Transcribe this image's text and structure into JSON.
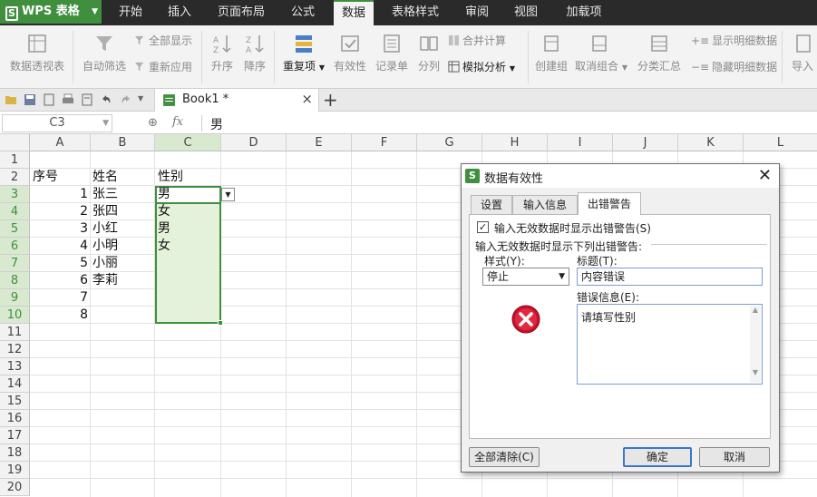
{
  "app": {
    "logo": "WPS 表格",
    "menu_tabs": [
      "开始",
      "插入",
      "页面布局",
      "公式",
      "数据",
      "表格样式",
      "审阅",
      "视图",
      "加载项"
    ],
    "active_tab": "数据"
  },
  "ribbon": {
    "pivot_table": "数据透视表",
    "auto_filter": "自动筛选",
    "show_all": "全部显示",
    "reapply": "重新应用",
    "sort_asc": "升序",
    "sort_desc": "降序",
    "duplicates": "重复项",
    "validation": "有效性",
    "record_form": "记录单",
    "text_to_columns": "分列",
    "consolidate": "合并计算",
    "what_if": "模拟分析",
    "group": "创建组",
    "ungroup": "取消组合",
    "subtotal": "分类汇总",
    "show_detail": "显示明细数据",
    "hide_detail": "隐藏明细数据",
    "import": "导入"
  },
  "document": {
    "tab_title": "Book1 *"
  },
  "formula_bar": {
    "name_box": "C3",
    "fx": "fx",
    "value": "男"
  },
  "sheet": {
    "columns": [
      "A",
      "B",
      "C",
      "D",
      "E",
      "F",
      "G",
      "H",
      "I",
      "J",
      "K",
      "L"
    ],
    "rows": [
      "1",
      "2",
      "3",
      "4",
      "5",
      "6",
      "7",
      "8",
      "9",
      "10",
      "11",
      "12",
      "13",
      "14",
      "15",
      "16",
      "17",
      "18",
      "19",
      "20"
    ],
    "header_row": {
      "a": "序号",
      "b": "姓名",
      "c": "性别"
    },
    "data": [
      {
        "a": "1",
        "b": "张三",
        "c": "男"
      },
      {
        "a": "2",
        "b": "张四",
        "c": "女"
      },
      {
        "a": "3",
        "b": "小红",
        "c": "男"
      },
      {
        "a": "4",
        "b": "小明",
        "c": "女"
      },
      {
        "a": "5",
        "b": "小丽",
        "c": ""
      },
      {
        "a": "6",
        "b": "李莉",
        "c": ""
      },
      {
        "a": "7",
        "b": "",
        "c": ""
      },
      {
        "a": "8",
        "b": "",
        "c": ""
      }
    ]
  },
  "dialog": {
    "title": "数据有效性",
    "tabs": [
      "设置",
      "输入信息",
      "出错警告"
    ],
    "active_tab": "出错警告",
    "show_alert_label": "输入无效数据时显示出错警告(S)",
    "show_alert_checked": true,
    "group_label": "输入无效数据时显示下列出错警告:",
    "style_label": "样式(Y):",
    "style_value": "停止",
    "title_label": "标题(T):",
    "title_value": "内容错误",
    "message_label": "错误信息(E):",
    "message_value": "请填写性别",
    "clear_all": "全部清除(C)",
    "ok": "确定",
    "cancel": "取消"
  },
  "colors": {
    "accent": "#3f8f3f",
    "selection_fill": "#e4f1db",
    "header_selected": "#d8e9cf",
    "titlebar": "#2a2a2a"
  }
}
